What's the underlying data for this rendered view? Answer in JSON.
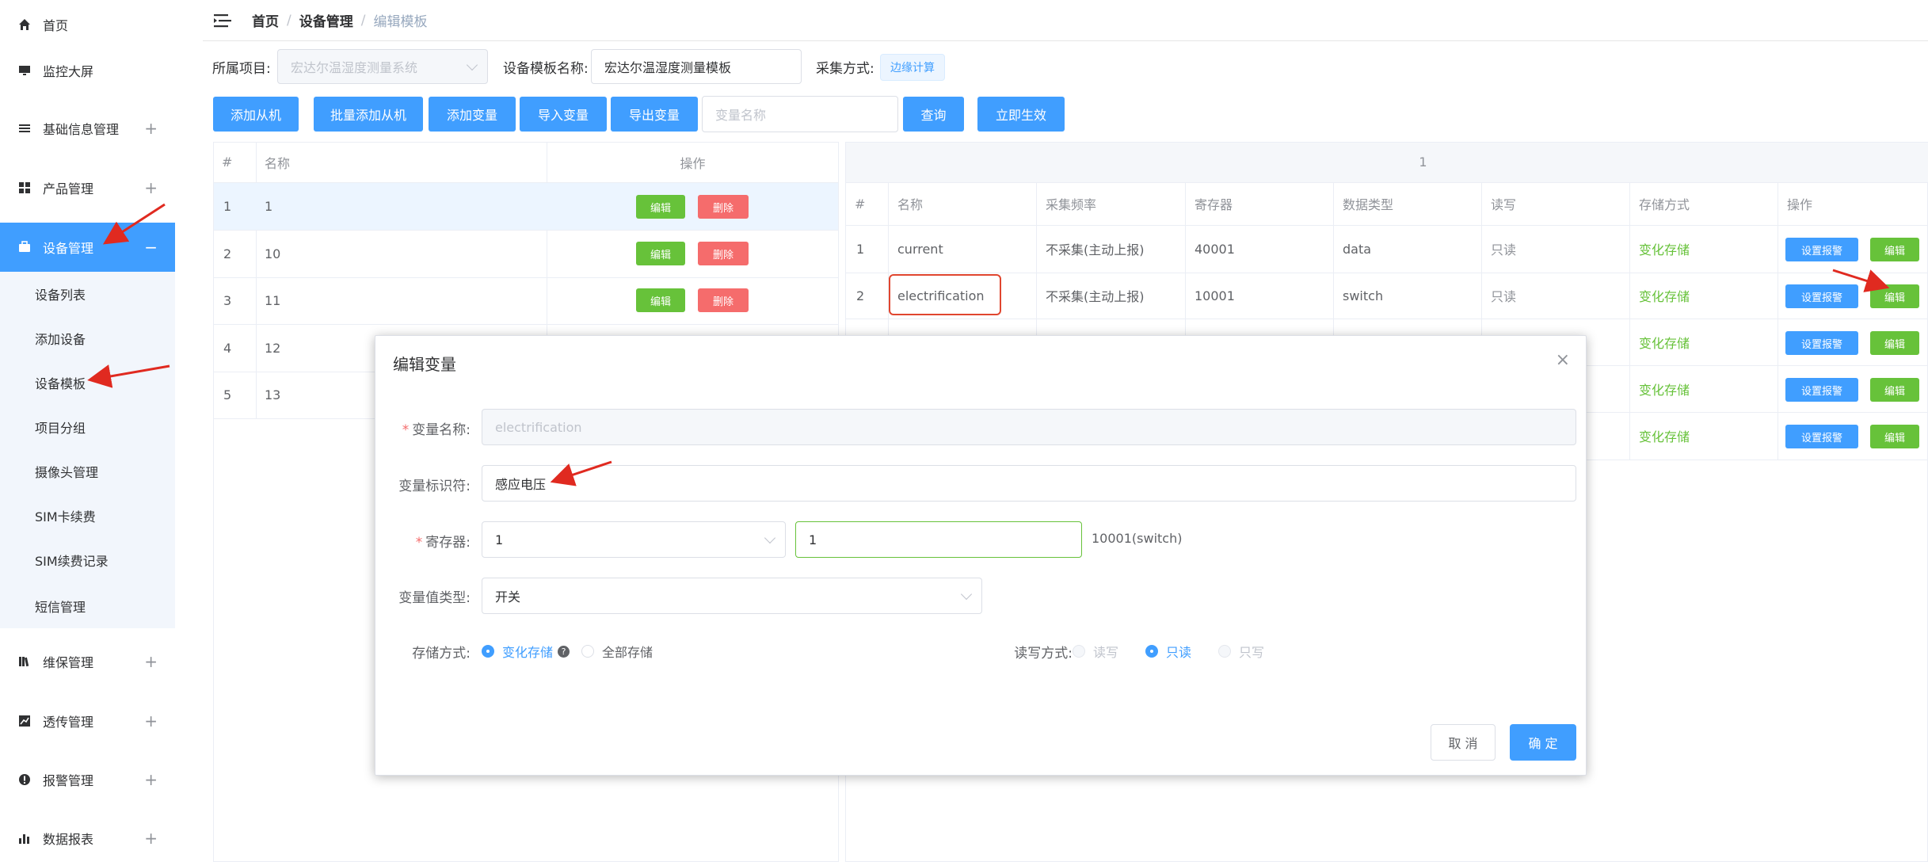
{
  "sidebar": {
    "items": [
      {
        "label": "首页",
        "icon": "home-icon"
      },
      {
        "label": "监控大屏",
        "icon": "monitor-icon"
      },
      {
        "label": "基础信息管理",
        "icon": "list-icon"
      },
      {
        "label": "产品管理",
        "icon": "grid-icon"
      },
      {
        "label": "设备管理",
        "icon": "briefcase-icon"
      },
      {
        "label": "维保管理",
        "icon": "book-icon"
      },
      {
        "label": "透传管理",
        "icon": "line-chart-icon"
      },
      {
        "label": "报警管理",
        "icon": "alert-icon"
      },
      {
        "label": "数据报表",
        "icon": "bar-chart-icon"
      }
    ],
    "submenu": [
      "设备列表",
      "添加设备",
      "设备模板",
      "项目分组",
      "摄像头管理",
      "SIM卡续费",
      "SIM续费记录",
      "短信管理"
    ],
    "plus": "+",
    "minus": "−"
  },
  "breadcrumb": {
    "home": "首页",
    "section": "设备管理",
    "current": "编辑模板",
    "sep": "/"
  },
  "filters": {
    "project_label": "所属项目:",
    "project_value": "宏达尔温湿度测量系统",
    "template_label": "设备模板名称:",
    "template_value": "宏达尔温湿度测量模板",
    "collect_label": "采集方式:",
    "collect_value": "边缘计算"
  },
  "toolbar": {
    "add_slave": "添加从机",
    "batch_add_slave": "批量添加从机",
    "add_var": "添加变量",
    "import_var": "导入变量",
    "export_var": "导出变量",
    "search_placeholder": "变量名称",
    "query": "查询",
    "apply": "立即生效"
  },
  "left_table": {
    "headers": [
      "#",
      "名称",
      "操作"
    ],
    "rows": [
      {
        "idx": "1",
        "name": "1"
      },
      {
        "idx": "2",
        "name": "10"
      },
      {
        "idx": "3",
        "name": "11"
      },
      {
        "idx": "4",
        "name": "12"
      },
      {
        "idx": "5",
        "name": "13"
      }
    ],
    "edit": "编辑",
    "delete": "删除"
  },
  "right_table": {
    "group_header": "1",
    "headers": [
      "#",
      "名称",
      "采集频率",
      "寄存器",
      "数据类型",
      "读写",
      "存储方式",
      "操作"
    ],
    "rows": [
      {
        "idx": "1",
        "name": "current",
        "freq": "不采集(主动上报)",
        "reg": "40001",
        "type": "data",
        "rw": "只读",
        "store": "变化存储"
      },
      {
        "idx": "2",
        "name": "electrification",
        "freq": "不采集(主动上报)",
        "reg": "10001",
        "type": "switch",
        "rw": "只读",
        "store": "变化存储"
      },
      {
        "store": "变化存储"
      },
      {
        "store": "变化存储"
      },
      {
        "store": "变化存储"
      }
    ],
    "alarm": "设置报警",
    "edit": "编辑"
  },
  "dialog": {
    "title": "编辑变量",
    "close": "×",
    "name_label": "变量名称:",
    "name_value": "electrification",
    "ident_label": "变量标识符:",
    "ident_value": "感应电压",
    "reg_label": "寄存器:",
    "reg_select": "1",
    "reg_input": "1",
    "reg_hint": "10001(switch)",
    "vtype_label": "变量值类型:",
    "vtype_value": "开关",
    "store_label": "存储方式:",
    "store_opt1": "变化存储",
    "store_opt2": "全部存储",
    "rw_label": "读写方式:",
    "rw_opt1": "读写",
    "rw_opt2": "只读",
    "rw_opt3": "只写",
    "required_mark": "*",
    "help": "?",
    "cancel": "取 消",
    "confirm": "确 定"
  }
}
